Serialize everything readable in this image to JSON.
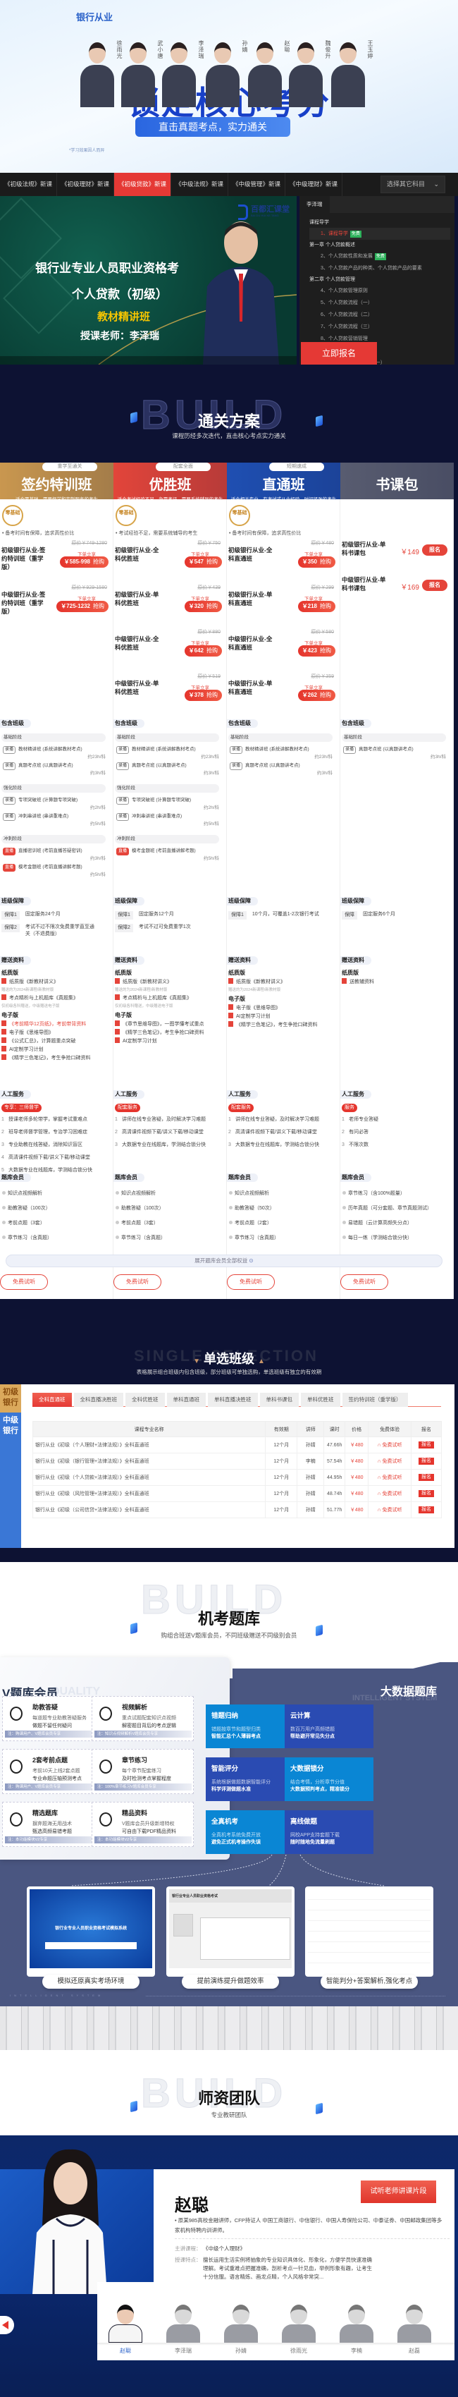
{
  "hero": {
    "brand": "银行从业",
    "teachers": [
      "徐雨光",
      "武小唐",
      "李泽瑞",
      "孙婧",
      "赵聪",
      "魏俊升",
      "王玉婷"
    ],
    "headline": "锁定核心考分",
    "subline": "直击真题考点，实力通关",
    "fineprint": "*学习效果因人而异",
    "headline_color": "#1840c8"
  },
  "course_tabs": {
    "items": [
      "《初级法规》新课",
      "《初级理财》新课",
      "《初级贷款》新课",
      "《中级法规》新课",
      "《中级管理》新课",
      "《中级理财》新课"
    ],
    "active_index": 2,
    "select_label": "选择其它科目",
    "active_color": "#e53935"
  },
  "video": {
    "logo": "百都汇课堂",
    "logo_en": "BAI DU HUI KE TANG",
    "title1": "银行业专业人员职业资格考",
    "title2": "个人贷款（初级）",
    "title3": "教材精讲班",
    "title4": "授课老师：李泽瑞"
  },
  "playlist": {
    "teacher_tab": "李泽瑞",
    "free_label": "免费",
    "groups": [
      {
        "chapter": "课程导学",
        "items": [
          {
            "label": "1、课程导学",
            "free": true,
            "active": true
          }
        ]
      },
      {
        "chapter": "第一章 个人贷款概述",
        "items": [
          {
            "label": "2、个人贷款性质和发展",
            "free": true
          },
          {
            "label": "3、个人贷款产品的种类、个人贷款产品的要素"
          }
        ]
      },
      {
        "chapter": "第二章 个人贷款管理",
        "items": [
          {
            "label": "4、个人贷款管理原则"
          },
          {
            "label": "5、个人贷款流程（一）"
          },
          {
            "label": "6、个人贷款流程（二）"
          },
          {
            "label": "7、个人贷款流程（三）"
          },
          {
            "label": "8、个人贷款营销管理"
          },
          {
            "label": "9、个人贷款定价管理"
          },
          {
            "label": "10、个人贷款风险管理（一）"
          },
          {
            "label": "11、个人贷款风险管理（二）"
          }
        ]
      }
    ],
    "signup_label": "立即报名"
  },
  "plans_section": {
    "title": "通关方案",
    "subtitle": "课程历经多次迭代，直击核心考点实力通关",
    "bg_word": "BUILD",
    "expand_label": "展开题库会员全部权益",
    "free_trial_label": "免费试听",
    "block_titles": {
      "classes": "包含班级",
      "guarantee": "班级保障",
      "gifts": "赠送资料",
      "service": "人工服务",
      "bank": "题库会员"
    }
  },
  "plans": [
    {
      "name": "签约特训班",
      "tag": "重学至通关",
      "desc": "适合零基础，需要督学和定制服务的考生",
      "color": "#c9974f",
      "badge": "零基础",
      "bullet": "• 备考时间有保障，追求高性价比",
      "products": [
        {
          "name": "初级银行从业-签约特训班（重学版）",
          "orig": "原价￥749-1280",
          "note": "下单立享",
          "price": "￥585-998",
          "btn": "抢购"
        },
        {
          "name": "中级银行从业-签约特训班（重学版）",
          "orig": "原价￥929-1580",
          "note": "下单立享",
          "price": "￥725-1232",
          "btn": "抢购"
        }
      ],
      "stages": [
        {
          "name": "基础阶段",
          "items": [
            {
              "type": "录播",
              "text": "教材精讲班 (系统讲解教材考点)",
              "dur": "约23h/科"
            },
            {
              "type": "录播",
              "text": "真题考点班 (以真题讲考点)",
              "dur": "约3h/科"
            }
          ]
        },
        {
          "name": "强化阶段",
          "items": [
            {
              "type": "录播",
              "text": "专项突破班 (计算题专项突破)",
              "dur": "约2h/科"
            },
            {
              "type": "录播",
              "text": "冲刺串讲班 (串讲重难点)",
              "dur": "约5h/科"
            }
          ]
        },
        {
          "name": "冲刺阶段",
          "items": [
            {
              "type": "直播",
              "text": "直播密训班 (考前直播答疑密训)",
              "dur": "约3h/科"
            },
            {
              "type": "直播",
              "text": "模考金题班 (考前直播讲解考题)",
              "dur": "约5h/科"
            }
          ]
        }
      ],
      "guarantee": [
        {
          "k": "保障1",
          "v": "固定服务24个月"
        },
        {
          "k": "保障2",
          "v": "考试不过不限次免费重学直至通关（不退费版）"
        }
      ],
      "gifts": [
        {
          "sub": "纸质版",
          "items": [
            {
              "t": "纸质版《新教材讲义》",
              "n": "赠送的为2024新课程/新教材版"
            },
            {
              "t": "考点精析与上机题库《真题集》",
              "n": "仅初级各科赠送，中级赠送电子版"
            }
          ]
        },
        {
          "sub": "电子版",
          "items": [
            {
              "t": "《考前精华12页纸》，考前带背资料",
              "red": true
            },
            {
              "t": "电子版《思维导图》"
            },
            {
              "t": "《公式汇总》，计算题重点突破"
            },
            {
              "t": "AI定制学习计划"
            },
            {
              "t": "《精学三色笔记》，考生争抢口碑资料"
            }
          ]
        }
      ],
      "service_badge": "专享：三师督学",
      "service": [
        "授课老师多轮带学，掌握考试重难点",
        "班导老师督学管理，专治学习困难症",
        "专业助教在线答疑，消除知识盲区",
        "高清课件视频下载/讲义下载/移动课堂",
        "大数据专业在线题库，学测结合锁分快"
      ],
      "bank": [
        "知识点视频解析",
        "助教答疑（100次）",
        "考前点题（3套）",
        "章节练习（含真题）",
        "历年真题"
      ]
    },
    {
      "name": "优胜班",
      "tag": "配套全面",
      "desc": "适合考试经验不足，急需考证，需要系统辅导的考生",
      "color": "#e2453a",
      "badge": "零基础",
      "bullet": "• 考试经验不足，需要系统辅导的考生",
      "products": [
        {
          "name": "初级银行从业-全科优胜班",
          "orig": "原价￥750",
          "note": "下单立享",
          "price": "￥547",
          "btn": "抢购"
        },
        {
          "name": "初级银行从业-单科优胜班",
          "orig": "原价￥439",
          "note": "下单立享",
          "price": "￥320",
          "btn": "抢购"
        },
        {
          "name": "中级银行从业-全科优胜班",
          "orig": "原价￥880",
          "note": "下单立享",
          "price": "￥642",
          "btn": "抢购"
        },
        {
          "name": "中级银行从业-单科优胜班",
          "orig": "原价￥519",
          "note": "下单立享",
          "price": "￥378",
          "btn": "抢购"
        }
      ],
      "stages": [
        {
          "name": "基础阶段",
          "items": [
            {
              "type": "录播",
              "text": "教材精讲班 (系统讲解教材考点)",
              "dur": "约23h/科"
            },
            {
              "type": "录播",
              "text": "真题考点班 (以真题讲考点)",
              "dur": "约3h/科"
            }
          ]
        },
        {
          "name": "强化阶段",
          "items": [
            {
              "type": "录播",
              "text": "专项突破班 (计算题专项突破)",
              "dur": "约2h/科"
            },
            {
              "type": "录播",
              "text": "冲刺串讲班 (串讲重难点)",
              "dur": "约5h/科"
            }
          ]
        },
        {
          "name": "冲刺阶段",
          "items": [
            {
              "type": "直播",
              "text": "模考金题班 (考前直播讲解考题)",
              "dur": "约5h/科"
            }
          ]
        }
      ],
      "guarantee": [
        {
          "k": "保障1",
          "v": "固定服务12个月"
        },
        {
          "k": "保障2",
          "v": "考试不过可免费重学1次"
        }
      ],
      "gifts": [
        {
          "sub": "纸质版",
          "items": [
            {
              "t": "纸质版《新教材讲义》",
              "n": "赠送的为2024新课程/新教材版"
            },
            {
              "t": "考点精析与上机题库《真题集》",
              "n": "仅初级各科赠送，中级赠送电子版"
            }
          ]
        },
        {
          "sub": "电子版",
          "items": [
            {
              "t": "《章节思维导图》，一图学懂考试重点"
            },
            {
              "t": "《精学三色笔记》，考生争抢口碑资料"
            },
            {
              "t": "AI定制学习计划"
            }
          ]
        }
      ],
      "service_badge": "配套服务",
      "service": [
        "讲师在线专业答疑，及时解决学习难题",
        "高清课件视频下载/讲义下载/移动课堂",
        "大数据专业在线题库，学测结合锁分快"
      ],
      "bank": [
        "知识点视频解析",
        "助教答疑（100次）",
        "考前点题（3套）",
        "章节练习（含真题）",
        "历年真题"
      ]
    },
    {
      "name": "直通班",
      "tag": "短期速成",
      "desc": "适合相关专业，有考试或从业经验，时间紧张的考生",
      "color": "#1f4fb2",
      "badge": "零基础",
      "bullet": "• 备考时间有保障，追求高性价比",
      "products": [
        {
          "name": "初级银行从业-全科直通班",
          "orig": "原价￥480",
          "note": "下单立享",
          "price": "￥350",
          "btn": "抢购"
        },
        {
          "name": "初级银行从业-单科直通班",
          "orig": "原价￥299",
          "note": "下单立享",
          "price": "￥218",
          "btn": "抢购"
        },
        {
          "name": "中级银行从业-全科直通班",
          "orig": "原价￥580",
          "note": "下单立享",
          "price": "￥423",
          "btn": "抢购"
        },
        {
          "name": "中级银行从业-单科直通班",
          "orig": "原价￥359",
          "note": "下单立享",
          "price": "￥262",
          "btn": "抢购"
        }
      ],
      "stages": [
        {
          "name": "基础阶段",
          "items": [
            {
              "type": "录播",
              "text": "教材精讲班 (系统讲解教材考点)",
              "dur": "约23h/科"
            },
            {
              "type": "录播",
              "text": "真题考点班 (以真题讲考点)",
              "dur": "约3h/科"
            }
          ]
        }
      ],
      "guarantee": [
        {
          "k": "保障1",
          "v": "10个月，可覆盖1-2次银行考试"
        }
      ],
      "gifts": [
        {
          "sub": "纸质版",
          "items": [
            {
              "t": "纸质版《新教材讲义》",
              "n": "赠送的为2024新课程/新教材版"
            }
          ]
        },
        {
          "sub": "电子版",
          "items": [
            {
              "t": "电子版《思维导图》"
            },
            {
              "t": "AI定制学习计划"
            },
            {
              "t": "《精学三色笔记》，考生争抢口碑资料"
            }
          ]
        }
      ],
      "service_badge": "配套服务",
      "service": [
        "讲师在线专业答疑，及时解决学习难题",
        "高清课件视频下载/讲义下载/移动课堂",
        "大数据专业在线题库，学测结合锁分快"
      ],
      "bank": [
        "知识点视频解析",
        "助教答疑（50次）",
        "考前点题（2套）",
        "章节练习（含真题）",
        "历年真题"
      ]
    },
    {
      "name": "书课包",
      "color": "#585c70",
      "books": [
        {
          "name": "初级银行从业-单科书课包",
          "price": "￥149",
          "btn": "报名"
        },
        {
          "name": "中级银行从业-单科书课包",
          "price": "￥169",
          "btn": "报名"
        }
      ],
      "stages": [
        {
          "name": "基础阶段",
          "items": [
            {
              "type": "录播",
              "text": "真题考点班 (以真题讲考点)",
              "dur": "约3h/科"
            }
          ]
        }
      ],
      "guarantee": [
        {
          "k": "保障",
          "v": "固定服务6个月"
        }
      ],
      "gifts": [
        {
          "sub": "纸质版",
          "items": [
            {
              "t": "送教辅资料"
            }
          ]
        }
      ],
      "service_badge": "服务",
      "service": [
        "老师专业答疑",
        "有问必答",
        "不限次数"
      ],
      "bank": [
        "章节练习（含100%题量）",
        "历年真题（可分套题、章节真题测试）",
        "易错题（云计算高频失分点）",
        "每日一练（学测结合锁分快）",
        "模拟试题（接近真题水准）"
      ]
    }
  ],
  "single": {
    "title": "单选班级",
    "bg_word": "SINGLE SELECTION",
    "subtitle": "表格展示组合班级内包含班级，部分班级可单独选购，单选班级有独立的有效期",
    "levels": [
      "初级银行",
      "中级银行"
    ],
    "tabs": [
      "全科直通班",
      "全科直播决胜班",
      "全科优胜班",
      "单科直通班",
      "单科直播决胜班",
      "单科书课包",
      "单科优胜班",
      "签约特训班（重学版）"
    ],
    "active_tab": 0,
    "headers": [
      "课程专业名称",
      "有效期",
      "讲师",
      "课时",
      "价格",
      "免费体验",
      "报名"
    ],
    "free_label": "免费试听",
    "sign_label": "报名",
    "rows": [
      [
        "银行从业《初级（个人理财+法律法规）》全科直通班",
        "12个月",
        "孙婧",
        "47.66h",
        "￥480"
      ],
      [
        "银行从业《初级（银行管理+法律法规）》全科直通班",
        "12个月",
        "李楠",
        "57.54h",
        "￥480"
      ],
      [
        "银行从业《初级（个人贷款+法律法规）》全科直通班",
        "12个月",
        "孙婧",
        "44.95h",
        "￥480"
      ],
      [
        "银行从业《初级（风险管理+法律法规）》全科直通班",
        "12个月",
        "孙婧",
        "48.74h",
        "￥480"
      ],
      [
        "银行从业《初级（公司信贷+法律法规）》全科直通班",
        "12个月",
        "孙婧",
        "51.77h",
        "￥480"
      ]
    ]
  },
  "bank_section": {
    "title": "机考题库",
    "subtitle": "购组合班送V题库会员，不同班级赠送不同级别会员",
    "v_title": "V题库会员",
    "v_bg": "QUALITY",
    "v_cards": [
      {
        "t": "助教答疑",
        "d1": "每道题专业助教答疑服务",
        "d2": "做题不留任何疑问",
        "n": "注：购课用户、V题库会员专享"
      },
      {
        "t": "视频解析",
        "d1": "重点试题配套知识点视频",
        "d2": "解密题目背后的考点逻辑",
        "n": "注：知识点视频解析V题库会员专享"
      },
      {
        "t": "2套考前点题",
        "d1": "考前10天上线2套点题",
        "d2": "专业命题压轴预测考点",
        "n": "注：购课用户、V题库会员专享"
      },
      {
        "t": "章节练习",
        "d1": "每个章节配套练习",
        "d2": "及时检测考点掌握程度",
        "n": "注：100%章节练习V题库会员专享"
      },
      {
        "t": "精选题库",
        "d1": "摒弃题海无用战术",
        "d2": "甄选高频易错考题",
        "n": "注：本功能模块V2专享"
      },
      {
        "t": "精品资料",
        "d1": "V题库会员升级新增特权",
        "d2": "可自由下载PDF精品资料",
        "n": "注：本功能模块V2专享"
      }
    ],
    "bd_title": "大数据题库",
    "bd_bg": "INTELLIGENT SYSTEM",
    "tiles": [
      {
        "t": "错题归纳",
        "d1": "错题按章节和题型归类",
        "d2": "智能汇总个人薄弱考点"
      },
      {
        "t": "云计算",
        "d1": "数百万用户高频错题",
        "d2": "帮助避开常见失分点"
      },
      {
        "t": "智能评分",
        "d1": "系统根据做题数据智能评分",
        "d2": "科学评测做题水准"
      },
      {
        "t": "大数据锁分",
        "d1": "结合考情，分析章节分值",
        "d2": "大数据预判考点，精准锁分"
      },
      {
        "t": "全真机考",
        "d1": "全真机考系统免费开放",
        "d2": "避免正式机考操作失误"
      },
      {
        "t": "离线做题",
        "d1": "网校APP支持套题下载",
        "d2": "随时随地免流量刷题"
      }
    ],
    "screens": [
      "模拟还原真实考场环境",
      "提前演练提升做题效率",
      "智能判分+答案解析,强化考点"
    ],
    "screen1_text": "银行业专业人员职业资格考试模拟系统",
    "screen2_text": "银行业专业人员职业资格考试",
    "footer_word": "INTELLIGENT SYSTEM"
  },
  "team": {
    "title": "师资团队",
    "subtitle": "专业教研团队",
    "current": {
      "name": "赵聪",
      "btn": "试听老师讲课片段",
      "bio": "• 原某985高校金融讲师，CFP持证人 中国工商银行、中信银行、中国人寿保险公司、中泰证券、中国邮政集团等多家机构特聘内训讲师。",
      "course_k": "主讲课程：",
      "course_v": "《中级个人理财》",
      "feature_k": "授课特点：",
      "feature_v": "擅长运用生活实例将抽象的专业知识具体化、形象化，方便学员快速准确理解。考试重难点把握准确，剖析考点一针见血，举例形象有趣，让考生十分信服。语言精炼、画龙点睛，个人风格非常突..."
    },
    "teachers": [
      "赵聪",
      "李泽瑞",
      "孙婧",
      "徐雨光",
      "李楠",
      "赵磊"
    ],
    "active_index": 0
  }
}
